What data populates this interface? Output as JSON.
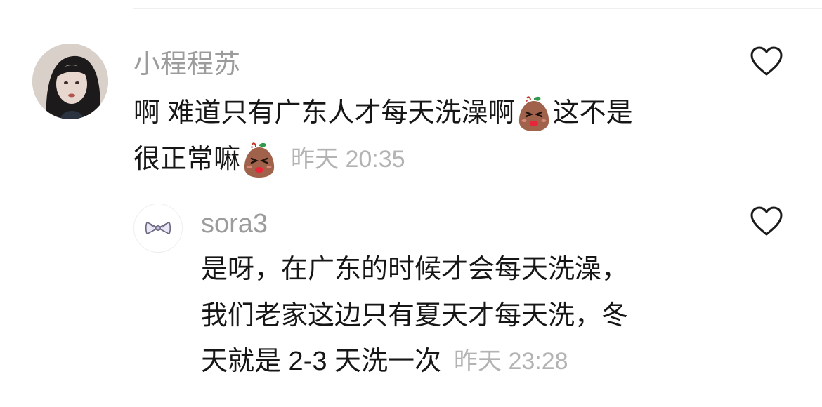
{
  "comments": [
    {
      "username": "小程程苏",
      "lines": [
        "啊 难道只有广东人才每天洗澡啊",
        "这不是",
        "很正常嘛"
      ],
      "emoji": "grimacing-bean-emoji",
      "time": "昨天 20:35",
      "liked": false
    },
    {
      "username": "sora3",
      "lines": [
        "是呀，在广东的时候才会每天洗澡，",
        "我们老家这边只有夏天才每天洗，冬",
        "天就是 2-3 天洗一次"
      ],
      "time": "昨天 23:28",
      "liked": false
    }
  ],
  "icons": {
    "like": "heart-outline-icon",
    "reply_avatar": "bow-icon"
  },
  "colors": {
    "text": "#161616",
    "username": "#9c9c9c",
    "time": "#b3b3b3",
    "divider": "#efefef",
    "emoji_body": "#a0624a",
    "emoji_leaf": "#2f9a4b"
  }
}
